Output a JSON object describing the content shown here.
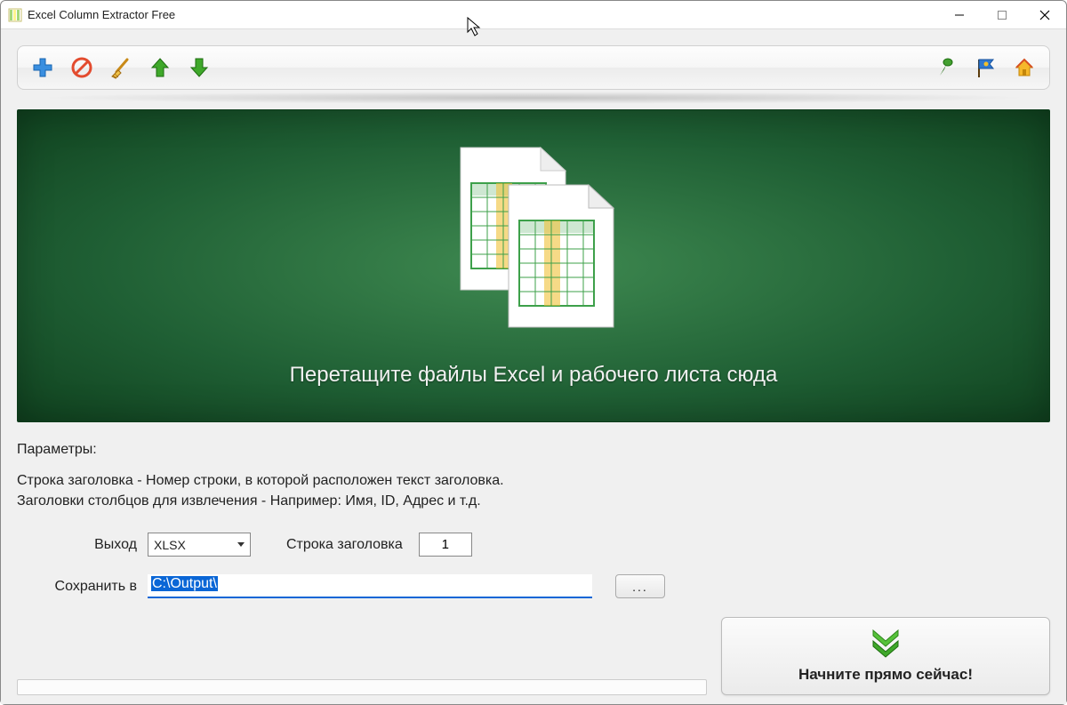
{
  "window": {
    "title": "Excel Column Extractor Free"
  },
  "dropzone": {
    "text": "Перетащите файлы Excel и рабочего листа сюда"
  },
  "params": {
    "heading": "Параметры:",
    "desc_line1": "Строка заголовка - Номер строки, в которой расположен текст заголовка.",
    "desc_line2": "Заголовки столбцов для извлечения - Например: Имя, ID, Адрес и т.д.",
    "output_label": "Выход",
    "output_value": "XLSX",
    "header_row_label": "Строка заголовка",
    "header_row_value": "1",
    "save_label": "Сохранить в",
    "save_path": "C:\\Output\\",
    "browse_label": "..."
  },
  "start": {
    "label": "Начните прямо сейчас!"
  }
}
